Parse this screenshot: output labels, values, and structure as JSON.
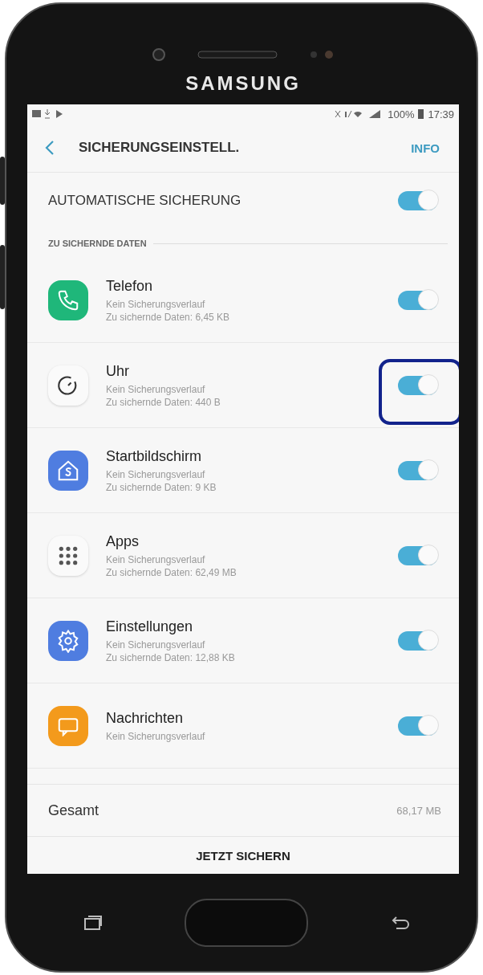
{
  "device": {
    "brand": "SAMSUNG"
  },
  "status_bar": {
    "battery": "100%",
    "time": "17:39"
  },
  "header": {
    "title": "SICHERUNGSEINSTELL.",
    "action": "INFO"
  },
  "auto_backup": {
    "label": "AUTOMATISCHE SICHERUNG",
    "on": true
  },
  "section": {
    "title": "ZU SICHERNDE DATEN"
  },
  "items": [
    {
      "name": "Telefon",
      "kind": "phone",
      "lines": [
        "Kein Sicherungsverlauf",
        "Zu sichernde Daten: 6,45 KB"
      ],
      "on": true,
      "highlighted": false
    },
    {
      "name": "Uhr",
      "kind": "clock",
      "lines": [
        "Kein Sicherungsverlauf",
        "Zu sichernde Daten: 440 B"
      ],
      "on": true,
      "highlighted": true
    },
    {
      "name": "Startbildschirm",
      "kind": "home",
      "lines": [
        "Kein Sicherungsverlauf",
        "Zu sichernde Daten: 9 KB"
      ],
      "on": true,
      "highlighted": false
    },
    {
      "name": "Apps",
      "kind": "apps",
      "lines": [
        "Kein Sicherungsverlauf",
        "Zu sichernde Daten: 62,49 MB"
      ],
      "on": true,
      "highlighted": false
    },
    {
      "name": "Einstellungen",
      "kind": "gear",
      "lines": [
        "Kein Sicherungsverlauf",
        "Zu sichernde Daten: 12,88 KB"
      ],
      "on": true,
      "highlighted": false
    },
    {
      "name": "Nachrichten",
      "kind": "message",
      "lines": [
        "Kein Sicherungsverlauf"
      ],
      "on": true,
      "highlighted": false
    }
  ],
  "total": {
    "label": "Gesamt",
    "value": "68,17 MB"
  },
  "button": {
    "label": "JETZT SICHERN"
  }
}
